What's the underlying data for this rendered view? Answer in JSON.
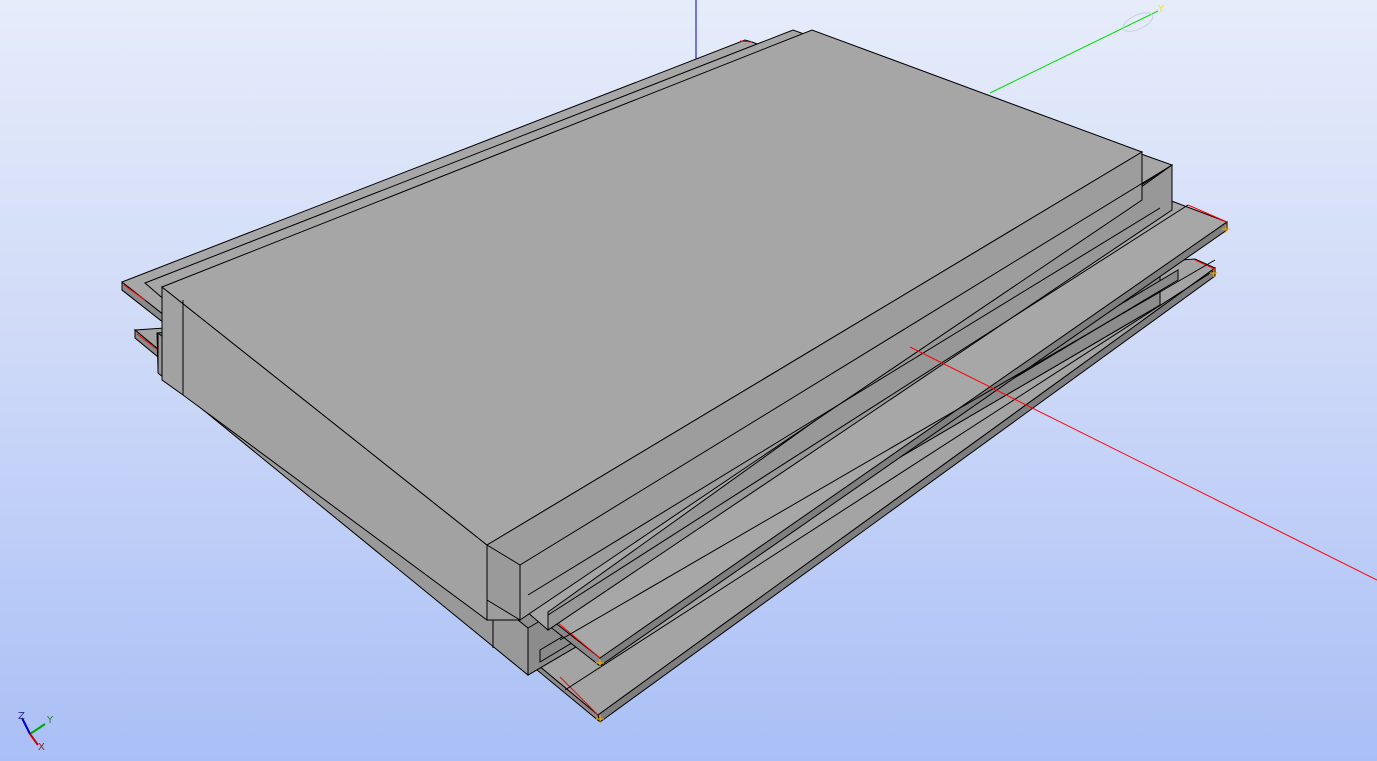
{
  "viewer": {
    "background_top": "#e6ecfa",
    "background_bottom": "#a9bff6",
    "shape_face_color": "#a6a6a6",
    "shape_edge_color": "#000000",
    "highlight_edge_color": "#ff0000",
    "vertex_marker_color": "#ffb000"
  },
  "world_axes": {
    "x": {
      "color": "#ff0000"
    },
    "y": {
      "color": "#00dd00",
      "label": "Y"
    },
    "z": {
      "color": "#0000cc"
    }
  },
  "triad": {
    "x_label": "X",
    "y_label": "Y",
    "z_label": "Z",
    "x_color": "#cc0000",
    "y_color": "#00aa00",
    "z_color": "#0000cc"
  }
}
